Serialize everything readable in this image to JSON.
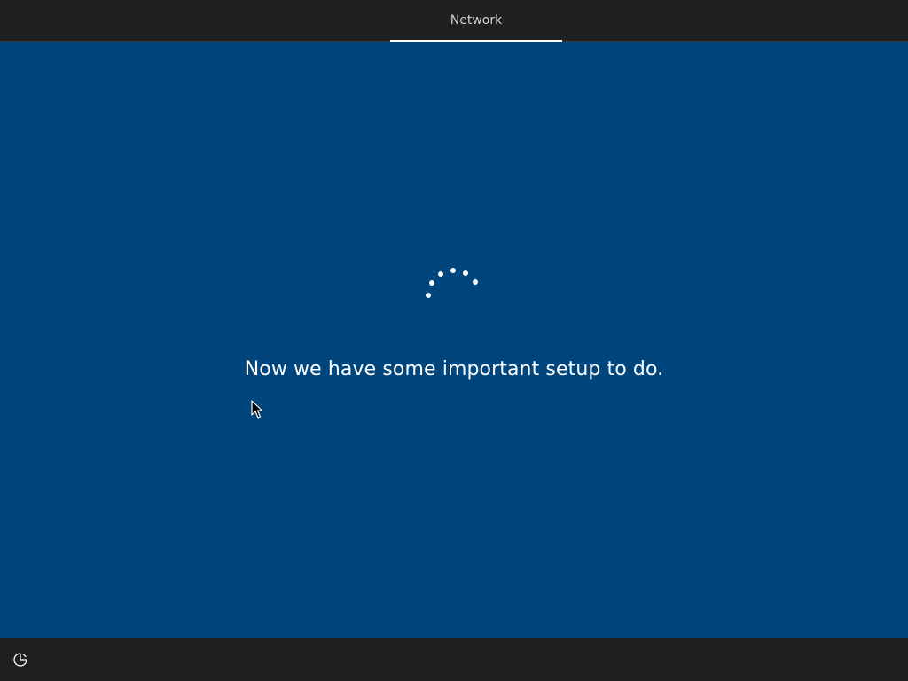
{
  "header": {
    "tabs": [
      {
        "label": "Network",
        "active": true
      }
    ]
  },
  "main": {
    "message": "Now we have some important setup to do.",
    "spinner_icon": "loading-spinner-icon"
  },
  "footer": {
    "ease_of_access_icon": "ease-of-access-icon"
  },
  "colors": {
    "background_blue": "#00457c",
    "bar_dark": "#202020",
    "text": "#ffffff"
  }
}
